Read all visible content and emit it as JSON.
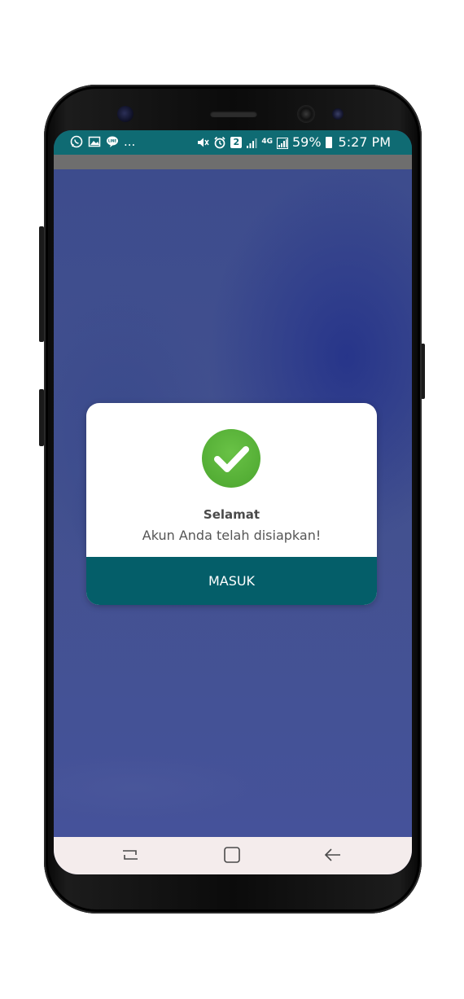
{
  "status_bar": {
    "left_icons": [
      "whatsapp-icon",
      "gallery-icon",
      "line-icon"
    ],
    "more": "...",
    "sim_badge": "2",
    "network": "4G",
    "battery_percent": "59%",
    "time": "5:27 PM"
  },
  "dialog": {
    "icon": "check-circle-icon",
    "title": "Selamat",
    "message": "Akun Anda telah disiapkan!",
    "button_label": "MASUK"
  },
  "nav_bar": {
    "buttons": [
      "recent-apps",
      "home",
      "back"
    ]
  },
  "colors": {
    "status_bar": "#0f6b73",
    "button": "#045e69",
    "check_green": "#56b236",
    "background": "#3e4d8e"
  }
}
